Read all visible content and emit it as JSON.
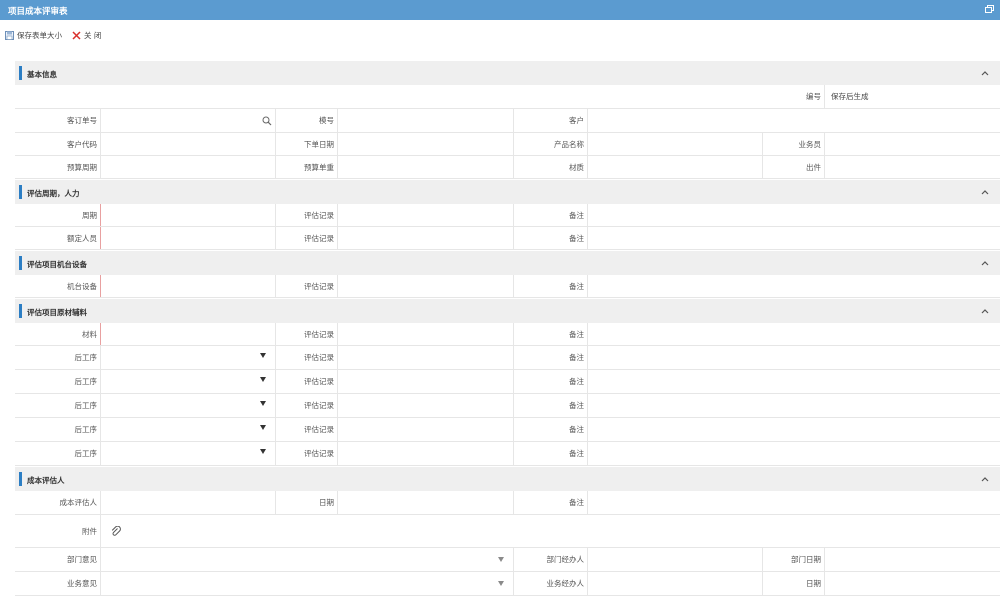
{
  "window": {
    "title": "项目成本评审表"
  },
  "toolbar": {
    "save_size": "保存表单大小",
    "close": "关 闭"
  },
  "sections": {
    "basic": "基本信息",
    "cycle": "评估周期，人力",
    "machine": "评估项目机台设备",
    "material": "评估项目原材辅料",
    "assessor": "成本评估人"
  },
  "basic": {
    "number_label": "编号",
    "number_value": "保存后生成",
    "order_label": "客订单号",
    "model_label": "模号",
    "customer_label": "客户",
    "customer_code_label": "客户代码",
    "order_date_label": "下单日期",
    "product_name_label": "产品名称",
    "salesman_label": "业务员",
    "budget_cycle_label": "预算周期",
    "budget_weight_label": "预算单重",
    "material_label": "材质",
    "cavity_label": "出件"
  },
  "cycle": {
    "period_label": "周期",
    "record_label": "评估记录",
    "remark_label": "备注",
    "staff_label": "额定人员"
  },
  "machine": {
    "device_label": "机台设备",
    "record_label": "评估记录",
    "remark_label": "备注"
  },
  "material": {
    "material_label": "材料",
    "post_process_label": "后工序",
    "record_label": "评估记录",
    "remark_label": "备注"
  },
  "assessor": {
    "assessor_label": "成本评估人",
    "date_label": "日期",
    "remark_label": "备注",
    "attachment_label": "附件",
    "dept_opinion_label": "部门意见",
    "dept_handler_label": "部门经办人",
    "dept_date_label": "部门日期",
    "biz_opinion_label": "业务意见",
    "biz_handler_label": "业务经办人",
    "biz_date_label": "日期"
  },
  "colors": {
    "title_bar": "#5b9bd0",
    "section_accent": "#2c7ec4",
    "section_bg": "#efefef"
  }
}
